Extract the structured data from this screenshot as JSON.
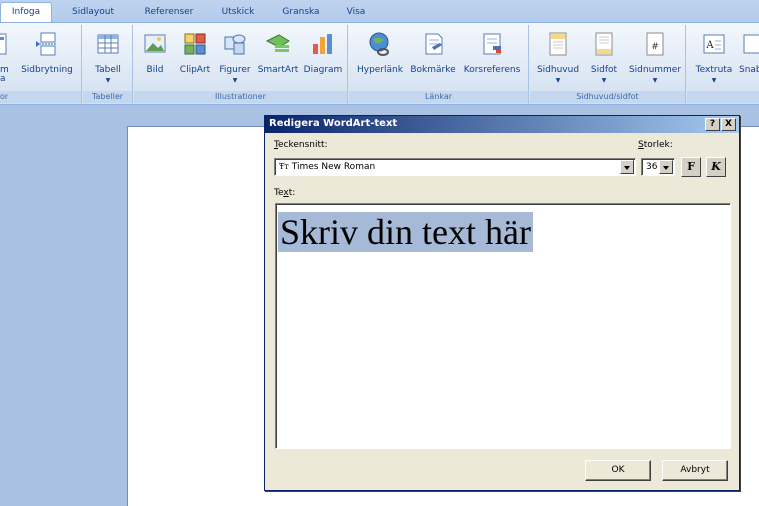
{
  "ribbon": {
    "tabs": [
      "Infoga",
      "Sidlayout",
      "Referenser",
      "Utskick",
      "Granska",
      "Visa"
    ],
    "active_tab": "Infoga",
    "groups": [
      {
        "label": "or",
        "buttons": [
          {
            "label": "m",
            "sub": "a",
            "icon": "cover-page-icon"
          },
          {
            "label": "Sidbrytning",
            "icon": "page-break-icon"
          }
        ]
      },
      {
        "label": "Tabeller",
        "buttons": [
          {
            "label": "Tabell",
            "icon": "table-icon"
          }
        ]
      },
      {
        "label": "Illustrationer",
        "buttons": [
          {
            "label": "Bild",
            "icon": "picture-icon"
          },
          {
            "label": "ClipArt",
            "icon": "clipart-icon"
          },
          {
            "label": "Figurer",
            "icon": "shapes-icon"
          },
          {
            "label": "SmartArt",
            "icon": "smartart-icon"
          },
          {
            "label": "Diagram",
            "icon": "chart-icon"
          }
        ]
      },
      {
        "label": "Länkar",
        "buttons": [
          {
            "label": "Hyperlänk",
            "icon": "hyperlink-icon"
          },
          {
            "label": "Bokmärke",
            "icon": "bookmark-icon"
          },
          {
            "label": "Korsreferens",
            "icon": "cross-reference-icon"
          }
        ]
      },
      {
        "label": "Sidhuvud/sidfot",
        "buttons": [
          {
            "label": "Sidhuvud",
            "icon": "header-icon"
          },
          {
            "label": "Sidfot",
            "icon": "footer-icon"
          },
          {
            "label": "Sidnummer",
            "icon": "page-number-icon"
          }
        ]
      },
      {
        "label": "",
        "buttons": [
          {
            "label": "Textruta",
            "icon": "textbox-icon"
          },
          {
            "label": "Snab",
            "icon": "quick-parts-icon"
          }
        ]
      }
    ]
  },
  "dialog": {
    "title": "Redigera WordArt-text",
    "help_button": "?",
    "close_button": "X",
    "font_label": "Teckensnitt:",
    "font_value": "Times New Roman",
    "font_icon_glyph": "Ŧт",
    "size_label": "Storlek:",
    "size_value": "36",
    "bold_label": "F",
    "italic_label": "K",
    "text_label": "Text:",
    "text_value": "Skriv din text här",
    "ok_label": "OK",
    "cancel_label": "Avbryt"
  },
  "colors": {
    "ribbon_text": "#15428b",
    "workspace": "#a9c1e3",
    "selection": "#a6b9d6",
    "dialog_bg": "#ece9d8",
    "title_start": "#0a246a",
    "title_end": "#a6caf0"
  }
}
